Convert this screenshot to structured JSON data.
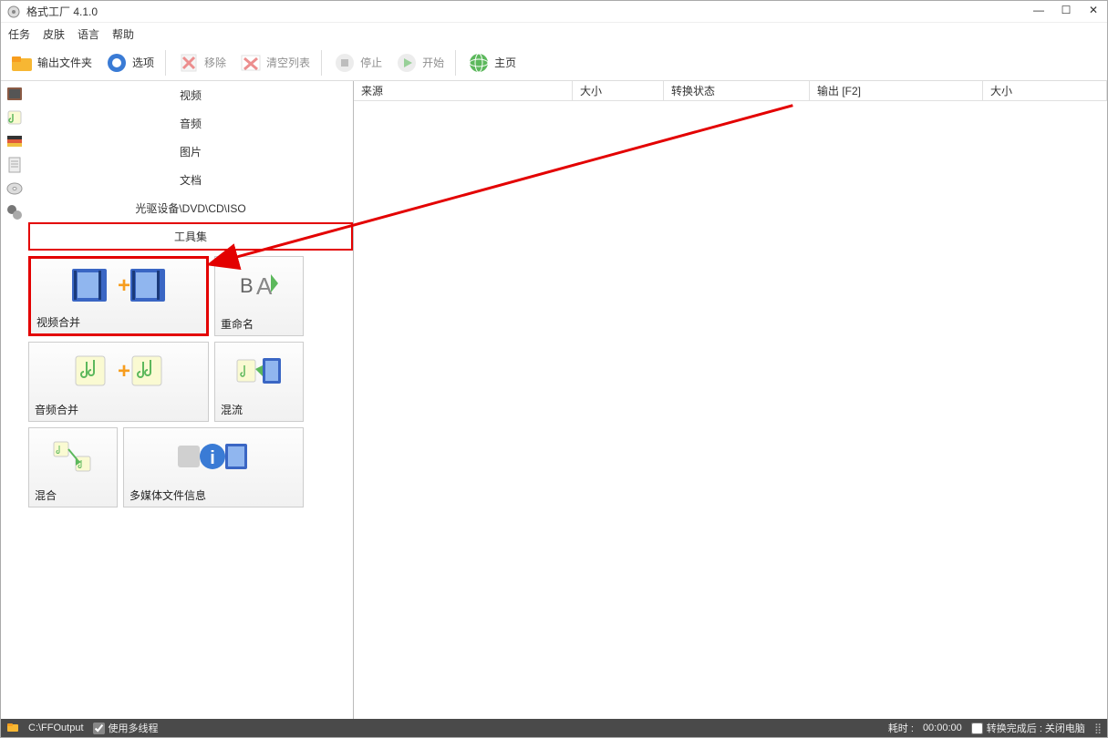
{
  "window": {
    "title": "格式工厂 4.1.0"
  },
  "menu": {
    "task": "任务",
    "skin": "皮肤",
    "language": "语言",
    "help": "帮助"
  },
  "toolbar": {
    "output_folder": "输出文件夹",
    "options": "选项",
    "remove": "移除",
    "clear_list": "清空列表",
    "stop": "停止",
    "start": "开始",
    "homepage": "主页"
  },
  "categories": {
    "video": "视频",
    "audio": "音频",
    "picture": "图片",
    "document": "文档",
    "dvd": "光驱设备\\DVD\\CD\\ISO",
    "toolset": "工具集"
  },
  "tools": {
    "video_merge": "视频合并",
    "rename": "重命名",
    "audio_merge": "音频合并",
    "mux": "混流",
    "mix": "混合",
    "media_info": "多媒体文件信息"
  },
  "table": {
    "source": "来源",
    "size": "大小",
    "status": "转换状态",
    "output": "输出 [F2]",
    "size2": "大小"
  },
  "status": {
    "output_path": "C:\\FFOutput",
    "multithread": "使用多线程",
    "elapsed_label": "耗时 :",
    "elapsed_value": "00:00:00",
    "after_convert": "转换完成后 : 关闭电脑"
  }
}
